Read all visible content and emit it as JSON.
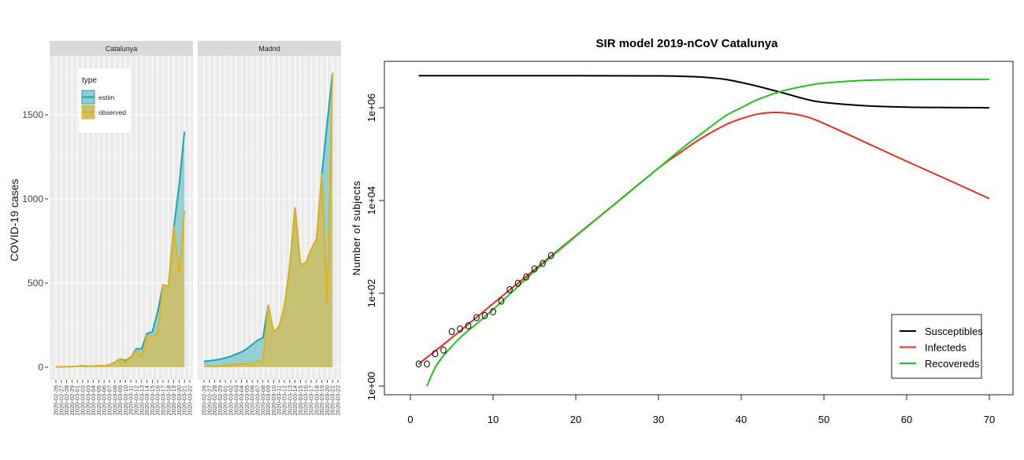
{
  "chart_data": [
    {
      "type": "area",
      "ylabel": "COVID-19 cases",
      "xlabel": "",
      "ylim": [
        0,
        1800
      ],
      "yticks": [
        0,
        500,
        1000,
        1500
      ],
      "grid": true,
      "legend": {
        "title": "type",
        "placement": "top-left",
        "entries": [
          "estim",
          "observed"
        ]
      },
      "colors": {
        "estim": "#1aa7b5",
        "observed": "#e2b21c",
        "estim_fill": "#8fcdd3",
        "observed_fill": "#c8c06e",
        "panel_bg": "#ebebeb",
        "strip_bg": "#d9d9d9"
      },
      "dates": [
        "2020-02-26",
        "2020-02-27",
        "2020-02-28",
        "2020-02-29",
        "2020-03-01",
        "2020-03-02",
        "2020-03-03",
        "2020-03-04",
        "2020-03-05",
        "2020-03-06",
        "2020-03-07",
        "2020-03-08",
        "2020-03-09",
        "2020-03-10",
        "2020-03-11",
        "2020-03-12",
        "2020-03-13",
        "2020-03-14",
        "2020-03-15",
        "2020-03-16",
        "2020-03-17",
        "2020-03-18",
        "2020-03-19",
        "2020-03-20",
        "2020-03-21",
        "2020-03-22"
      ],
      "panels": [
        {
          "name": "Catalunya",
          "series": [
            {
              "name": "estim",
              "values": [
                3,
                2,
                3,
                4,
                5,
                10,
                5,
                6,
                10,
                8,
                15,
                30,
                50,
                40,
                60,
                110,
                110,
                200,
                210,
                330,
                490,
                480,
                830,
                1080,
                1400
              ]
            },
            {
              "name": "observed",
              "values": [
                3,
                2,
                3,
                4,
                5,
                10,
                5,
                6,
                10,
                8,
                15,
                30,
                50,
                30,
                60,
                100,
                60,
                190,
                180,
                200,
                490,
                480,
                840,
                560,
                930
              ]
            }
          ]
        },
        {
          "name": "Madrid",
          "series": [
            {
              "name": "estim",
              "values": [
                35,
                38,
                42,
                48,
                55,
                65,
                78,
                90,
                110,
                135,
                160,
                175,
                370,
                210,
                240,
                360,
                600,
                950,
                610,
                620,
                700,
                760,
                1150,
                1450,
                1750
              ]
            },
            {
              "name": "observed",
              "values": [
                5,
                5,
                5,
                8,
                12,
                15,
                18,
                20,
                20,
                20,
                40,
                25,
                370,
                210,
                240,
                360,
                600,
                950,
                610,
                620,
                700,
                760,
                1150,
                380,
                1750
              ]
            }
          ]
        }
      ]
    },
    {
      "type": "line",
      "title": "SIR model 2019-nCoV  Catalunya",
      "ylabel": "Number of subjects",
      "xlabel": "",
      "xlim": [
        0,
        70
      ],
      "xticks": [
        0,
        10,
        20,
        30,
        40,
        50,
        60,
        70
      ],
      "y_scale": "log",
      "yticks": [
        1,
        100,
        10000,
        1000000
      ],
      "ytick_labels": [
        "1e+00",
        "1e+02",
        "1e+04",
        "1e+06"
      ],
      "grid": false,
      "legend": {
        "placement": "bottom-right",
        "entries": [
          "Susceptibles",
          "Infecteds",
          "Recovereds"
        ]
      },
      "series": [
        {
          "name": "Susceptibles",
          "color": "#000000",
          "x": [
            1,
            10,
            20,
            30,
            33,
            35,
            38,
            40,
            42,
            45,
            48,
            50,
            55,
            60,
            65,
            70
          ],
          "y": [
            4900000,
            4900000,
            4900000,
            4850000,
            4750000,
            4600000,
            4100000,
            3500000,
            2900000,
            2100000,
            1500000,
            1300000,
            1100000,
            1030000,
            1010000,
            1000000
          ]
        },
        {
          "name": "Infecteds",
          "color": "#ee2a1f",
          "x": [
            1,
            5,
            10,
            15,
            20,
            25,
            30,
            33,
            35,
            38,
            40,
            42,
            44,
            46,
            48,
            50,
            55,
            60,
            65,
            70
          ],
          "y": [
            3,
            11,
            60,
            325,
            1740,
            9300,
            50000,
            120000,
            210000,
            420000,
            580000,
            730000,
            790000,
            750000,
            630000,
            460000,
            180000,
            70000,
            28000,
            11000
          ]
        },
        {
          "name": "Recovereds",
          "color": "#1ec41e",
          "x": [
            2,
            3,
            4,
            6,
            8,
            10,
            12,
            15,
            20,
            25,
            30,
            33,
            35,
            38,
            40,
            42,
            45,
            48,
            50,
            55,
            60,
            70
          ],
          "y": [
            1,
            2.5,
            4.5,
            11,
            22,
            45,
            95,
            300,
            1700,
            9200,
            50000,
            140000,
            260000,
            650000,
            1000000,
            1500000,
            2300000,
            3000000,
            3400000,
            3900000,
            4050000,
            4100000
          ]
        },
        {
          "name": "observed",
          "type": "points",
          "color": "#000000",
          "x": [
            1,
            2,
            3,
            4,
            5,
            6,
            7,
            8,
            9,
            10,
            11,
            12,
            13,
            14,
            15,
            16,
            17
          ],
          "y": [
            3,
            3,
            5,
            6,
            15,
            17,
            20,
            30,
            33,
            40,
            68,
            120,
            165,
            225,
            335,
            440,
            650
          ]
        }
      ]
    }
  ]
}
